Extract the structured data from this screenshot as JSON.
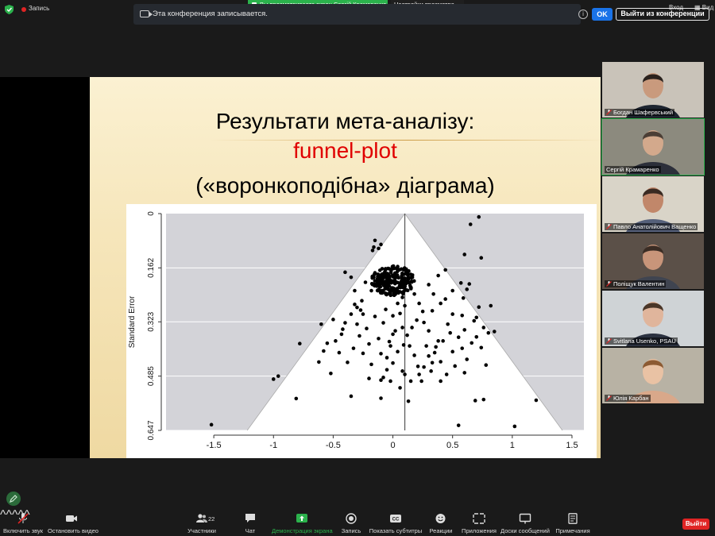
{
  "top": {
    "rec_label": "Запись",
    "share_banner": "Вы просматриваете экран Сергій Крамаренко",
    "view_options": "Настройки просмотра",
    "exit_full": "Вход",
    "view": "Вид"
  },
  "notice": {
    "text": "Эта конференция записывается.",
    "ok": "OK",
    "leave": "Выйти из конференции"
  },
  "slide": {
    "title_line1": "Результати мета-аналізу:",
    "title_line2": "funnel-plot",
    "title_line3": "(«воронкоподібна» діаграма)",
    "title_line2_color": "#e00000"
  },
  "chart_data": {
    "type": "scatter",
    "title": "",
    "ylabel": "Standard Error",
    "xlabel": "",
    "xlim": [
      -1.9,
      1.6
    ],
    "ylim": [
      0.647,
      0
    ],
    "y_inverted": true,
    "x_ticks": [
      "-1.5",
      "-1",
      "-0.5",
      "0",
      "0.5",
      "1",
      "1.5"
    ],
    "y_ticks": [
      "0",
      "0.162",
      "0.323",
      "0.485",
      "0.647"
    ],
    "pooled_estimate": 0.1,
    "funnel": {
      "apex": [
        0.1,
        0
      ],
      "base_left": -1.22,
      "base_right": 1.42,
      "base_se": 0.647
    },
    "points": [
      [
        -1.52,
        0.63
      ],
      [
        -1.0,
        0.494
      ],
      [
        -0.96,
        0.485
      ],
      [
        -0.81,
        0.552
      ],
      [
        -0.78,
        0.388
      ],
      [
        -0.58,
        0.41
      ],
      [
        -0.55,
        0.387
      ],
      [
        -0.62,
        0.443
      ],
      [
        -0.52,
        0.477
      ],
      [
        -0.45,
        0.415
      ],
      [
        -0.43,
        0.36
      ],
      [
        -0.4,
        0.326
      ],
      [
        -0.38,
        0.444
      ],
      [
        -0.35,
        0.3
      ],
      [
        -0.33,
        0.402
      ],
      [
        -0.32,
        0.271
      ],
      [
        -0.28,
        0.365
      ],
      [
        -0.27,
        0.288
      ],
      [
        -0.25,
        0.417
      ],
      [
        -0.22,
        0.343
      ],
      [
        -0.2,
        0.389
      ],
      [
        -0.18,
        0.45
      ],
      [
        -0.15,
        0.307
      ],
      [
        -0.12,
        0.373
      ],
      [
        -0.1,
        0.418
      ],
      [
        -0.08,
        0.326
      ],
      [
        -0.05,
        0.466
      ],
      [
        -0.03,
        0.382
      ],
      [
        0.0,
        0.446
      ],
      [
        0.02,
        0.35
      ],
      [
        0.04,
        0.412
      ],
      [
        0.06,
        0.298
      ],
      [
        0.08,
        0.47
      ],
      [
        0.09,
        0.392
      ],
      [
        -0.1,
        0.551
      ],
      [
        -0.35,
        0.545
      ],
      [
        -0.1,
        0.497
      ],
      [
        -0.2,
        0.492
      ],
      [
        -0.08,
        0.489
      ],
      [
        0.22,
        0.48
      ],
      [
        0.24,
        0.5
      ],
      [
        0.26,
        0.458
      ],
      [
        0.3,
        0.425
      ],
      [
        0.33,
        0.445
      ],
      [
        0.36,
        0.398
      ],
      [
        0.4,
        0.442
      ],
      [
        0.42,
        0.38
      ],
      [
        0.45,
        0.48
      ],
      [
        0.48,
        0.356
      ],
      [
        0.5,
        0.412
      ],
      [
        0.52,
        0.455
      ],
      [
        0.55,
        0.369
      ],
      [
        0.58,
        0.402
      ],
      [
        0.6,
        0.347
      ],
      [
        0.62,
        0.435
      ],
      [
        0.66,
        0.386
      ],
      [
        0.68,
        0.32
      ],
      [
        0.7,
        0.368
      ],
      [
        0.74,
        0.4
      ],
      [
        0.78,
        0.452
      ],
      [
        0.8,
        0.356
      ],
      [
        0.85,
        0.352
      ],
      [
        0.58,
        0.304
      ],
      [
        0.59,
        0.252
      ],
      [
        0.62,
        0.226
      ],
      [
        0.64,
        0.21
      ],
      [
        0.7,
        0.31
      ],
      [
        0.72,
        0.279
      ],
      [
        0.76,
        0.34
      ],
      [
        0.82,
        0.275
      ],
      [
        0.65,
        0.032
      ],
      [
        0.72,
        0.01
      ],
      [
        0.6,
        0.122
      ],
      [
        0.74,
        0.132
      ],
      [
        0.57,
        0.207
      ],
      [
        0.44,
        0.168
      ],
      [
        0.38,
        0.185
      ],
      [
        0.3,
        0.212
      ],
      [
        0.34,
        0.24
      ],
      [
        0.4,
        0.268
      ],
      [
        0.25,
        0.292
      ],
      [
        0.2,
        0.318
      ],
      [
        0.16,
        0.34
      ],
      [
        0.12,
        0.363
      ],
      [
        0.14,
        0.395
      ],
      [
        0.18,
        0.423
      ],
      [
        0.21,
        0.456
      ],
      [
        0.15,
        0.5
      ],
      [
        0.13,
        0.56
      ],
      [
        0.55,
        0.632
      ],
      [
        0.69,
        0.558
      ],
      [
        0.76,
        0.555
      ],
      [
        1.02,
        0.635
      ],
      [
        1.2,
        0.557
      ],
      [
        0.6,
        0.475
      ],
      [
        -0.15,
        0.08
      ],
      [
        -0.16,
        0.1
      ],
      [
        -0.17,
        0.11
      ],
      [
        -0.1,
        0.092
      ],
      [
        -0.12,
        0.104
      ],
      [
        -0.25,
        0.3
      ],
      [
        -0.06,
        0.286
      ],
      [
        0.04,
        0.268
      ],
      [
        0.08,
        0.25
      ],
      [
        0.1,
        0.275
      ],
      [
        0.26,
        0.325
      ],
      [
        0.3,
        0.35
      ],
      [
        0.33,
        0.29
      ],
      [
        0.44,
        0.255
      ],
      [
        0.5,
        0.23
      ],
      [
        0.5,
        0.3
      ],
      [
        0.46,
        0.33
      ],
      [
        -0.42,
        0.345
      ],
      [
        -0.3,
        0.33
      ],
      [
        -0.26,
        0.26
      ],
      [
        -0.35,
        0.19
      ],
      [
        -0.4,
        0.175
      ],
      [
        -0.23,
        0.205
      ],
      [
        -0.32,
        0.23
      ],
      [
        -0.18,
        0.23
      ],
      [
        -0.05,
        0.24
      ],
      [
        0.0,
        0.305
      ],
      [
        0.18,
        0.24
      ],
      [
        0.22,
        0.268
      ],
      [
        -0.48,
        0.38
      ],
      [
        -0.5,
        0.316
      ],
      [
        -0.6,
        0.33
      ],
      [
        -0.3,
        0.28
      ],
      [
        0.38,
        0.38
      ],
      [
        0.35,
        0.415
      ],
      [
        0.28,
        0.395
      ],
      [
        0.32,
        0.47
      ],
      [
        0.4,
        0.5
      ],
      [
        0.1,
        0.48
      ],
      [
        0.06,
        0.52
      ],
      [
        -0.02,
        0.5
      ],
      [
        -0.05,
        0.43
      ],
      [
        -0.02,
        0.395
      ],
      [
        0.0,
        0.36
      ],
      [
        0.08,
        0.34
      ]
    ],
    "cluster": {
      "center": [
        0.0,
        0.2
      ],
      "spread_x": 0.18,
      "spread_y": 0.045,
      "count": 230
    }
  },
  "participants": [
    {
      "name": "Богдан Шафервський",
      "muted": true,
      "bg": "#c9c3b9",
      "skin": "#c99a7d",
      "hair": "#2a221e",
      "shirt": "#1e2530"
    },
    {
      "name": "Сергій Крамаренко",
      "muted": false,
      "active": true,
      "bg": "#8c8a7e",
      "skin": "#d3a98c",
      "hair": "#4b3e35",
      "shirt": "#2c2f3a"
    },
    {
      "name": "Павло Анатолійович Ващенко",
      "muted": true,
      "bg": "#d9d4c8",
      "skin": "#c1876a",
      "hair": "#3a2a22",
      "shirt": "#55607a"
    },
    {
      "name": "Поліщук Валентин",
      "muted": true,
      "bg": "#5b5048",
      "skin": "#c8957a",
      "hair": "#3a2c24",
      "shirt": "#3f4450"
    },
    {
      "name": "Svitlana Usenko, PSAU",
      "muted": true,
      "bg": "#cfd3d6",
      "skin": "#e0b59c",
      "hair": "#4a3628",
      "shirt": "#2b3140"
    },
    {
      "name": "Юлія Карбан",
      "muted": true,
      "bg": "#b8b2a4",
      "skin": "#e9c2a4",
      "hair": "#8c5a32",
      "shirt": "#d9a88a"
    }
  ],
  "toolbar": {
    "mic": "Включить звук",
    "video": "Остановить видео",
    "participants": "Участники",
    "participants_count": "22",
    "chat": "Чат",
    "share": "Демонстрация экрана",
    "record": "Запись",
    "captions": "Показать субтитры",
    "reactions": "Реакции",
    "apps": "Приложения",
    "whiteboards": "Доски сообщений",
    "notes": "Примечания",
    "end": "Выйти"
  }
}
